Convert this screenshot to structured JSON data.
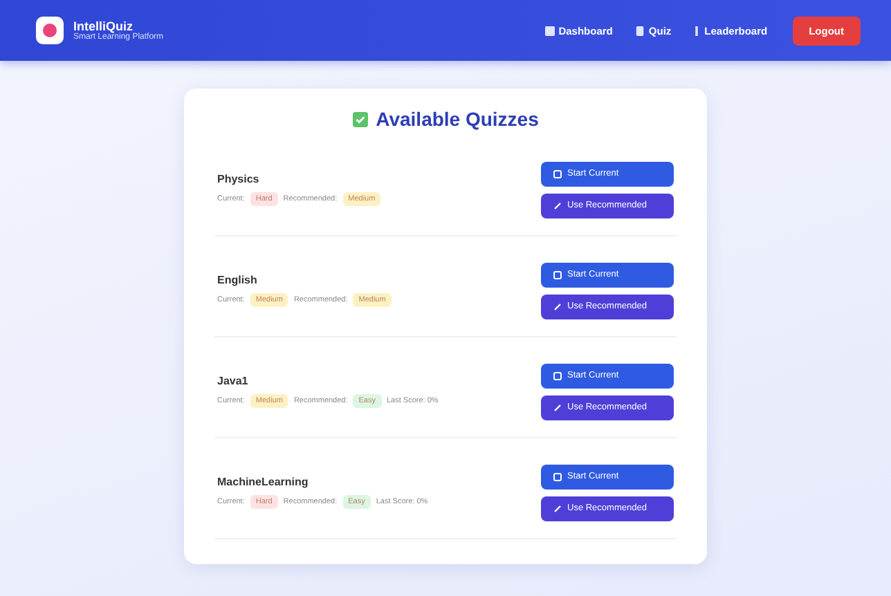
{
  "brand": {
    "name": "IntelliQuiz",
    "tagline": "Smart Learning Platform"
  },
  "nav": [
    {
      "label": "Dashboard",
      "kind": "dashboard"
    },
    {
      "label": "Quiz",
      "kind": "quiz"
    },
    {
      "label": "Leaderboard",
      "kind": "leaderboard"
    }
  ],
  "logout": "Logout",
  "title": "Available Quizzes",
  "quizzes": [
    {
      "name": "Physics",
      "current_label": "Current:",
      "current": {
        "text": "Hard",
        "color": "#fde2e2"
      },
      "recommended_label": "Recommended:",
      "recommended": {
        "text": "Medium",
        "color": "#fdf1c4"
      },
      "start": "Start Current",
      "use": "Use Recommended"
    },
    {
      "name": "English",
      "current_label": "Current:",
      "current": {
        "text": "Medium",
        "color": "#fdf1c4"
      },
      "recommended_label": "Recommended:",
      "recommended": {
        "text": "Medium",
        "color": "#fdf1c4"
      },
      "start": "Start Current",
      "use": "Use Recommended"
    },
    {
      "name": "Java1",
      "current_label": "Current:",
      "current": {
        "text": "Medium",
        "color": "#fdf1c4"
      },
      "recommended_label": "Recommended:",
      "recommended": {
        "text": "Easy",
        "color": "#ddf5e3"
      },
      "last_score": "Last Score: 0%",
      "start": "Start Current",
      "use": "Use Recommended"
    },
    {
      "name": "MachineLearning",
      "current_label": "Current:",
      "current": {
        "text": "Hard",
        "color": "#fde2e2"
      },
      "recommended_label": "Recommended:",
      "recommended": {
        "text": "Easy",
        "color": "#ddf5e3"
      },
      "last_score": "Last Score: 0%",
      "start": "Start Current",
      "use": "Use Recommended"
    }
  ]
}
